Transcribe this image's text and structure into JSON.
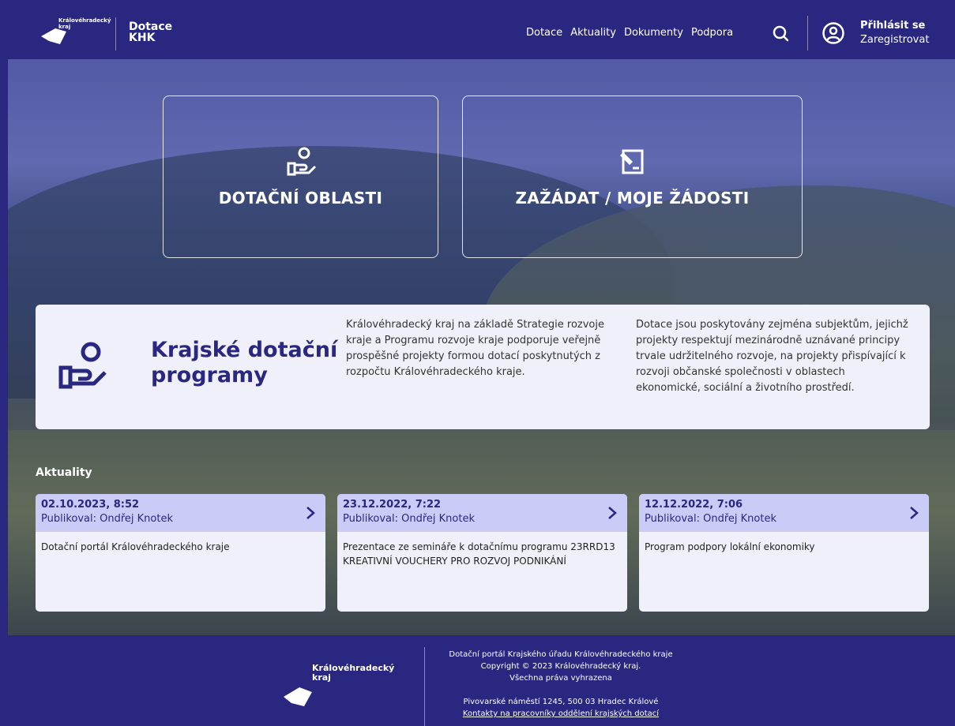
{
  "header": {
    "logo_text": "Královéhradecký kraj",
    "brand_line1": "Dotace",
    "brand_line2": "KHK",
    "nav": [
      "Dotace",
      "Aktuality",
      "Dokumenty",
      "Podpora"
    ],
    "login": "Přihlásit se",
    "register": "Zaregistrovat",
    "icons": [
      "search-icon",
      "user-circle-icon"
    ]
  },
  "tiles": [
    {
      "label": "DOTAČNÍ OBLASTI",
      "icon": "hand-user-icon"
    },
    {
      "label": "ZAŽÁDAT / MOJE ŽÁDOSTI",
      "icon": "form-edit-icon"
    }
  ],
  "info": {
    "title": "Krajské dotační programy",
    "col1": "Královéhradecký kraj na základě Strategie rozvoje kraje a Programu rozvoje kraje podporuje veřejně prospěšné projekty formou dotací poskytnutých z rozpočtu Královéhradeckého kraje.",
    "col2": "Dotace jsou poskytovány zejména subjektům, jejichž projekty respektují mezinárodně uznávané principy trvale udržitelného rozvoje, na projekty přispívající k rozvoji občanské společnosti v oblastech ekonomické, sociální a životního prostředí."
  },
  "news": {
    "title": "Aktuality",
    "items": [
      {
        "date": "02.10.2023, 8:52",
        "author": "Publikoval: Ondřej Knotek",
        "text": "Dotační portál Královéhradeckého kraje"
      },
      {
        "date": "23.12.2022, 7:22",
        "author": "Publikoval: Ondřej Knotek",
        "text": "Prezentace ze semináře k dotačnímu programu 23RRD13 KREATIVNÍ VOUCHERY PRO ROZVOJ PODNIKÁNÍ"
      },
      {
        "date": "12.12.2022, 7:06",
        "author": "Publikoval: Ondřej Knotek",
        "text": "Program podpory lokální ekonomiky"
      }
    ]
  },
  "footer": {
    "logo_text": "Královéhradecký kraj",
    "line1": "Dotační portál Krajského úřadu Královéhradeckého kraje",
    "line2": "Copyright © 2023 Královéhradecký kraj.",
    "line3": "Všechna práva vyhrazena",
    "address": "Pivovarské náměstí 1245, 500 03 Hradec Králové",
    "contacts_link": "Kontakty na pracovníky oddělení krajských dotací"
  },
  "colors": {
    "primary": "#2a2781",
    "card_bg": "#f0f0fb",
    "card_head": "#cbcbf7"
  }
}
